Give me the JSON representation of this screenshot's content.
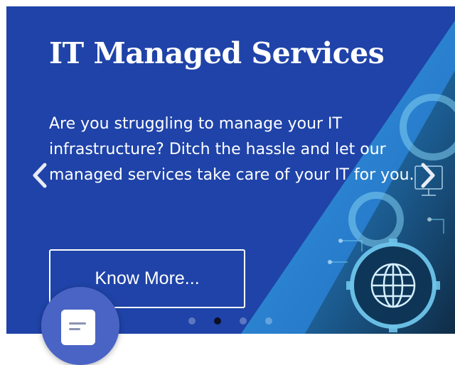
{
  "slide": {
    "title": "IT Managed Services",
    "description": "Are you struggling to manage your IT infrastructure? Ditch the hassle and let our managed services take care of your IT for you.",
    "cta_label": "Know More..."
  },
  "carousel": {
    "prev_icon": "chevron-left-icon",
    "next_icon": "chevron-right-icon",
    "dot_count": 4,
    "active_index": 1
  },
  "chat_widget": {
    "icon": "message-icon"
  },
  "colors": {
    "background": "#1f43a8",
    "accent_stripe": "#2a8fd8",
    "text": "#ffffff",
    "active_dot": "#0b0f24"
  }
}
